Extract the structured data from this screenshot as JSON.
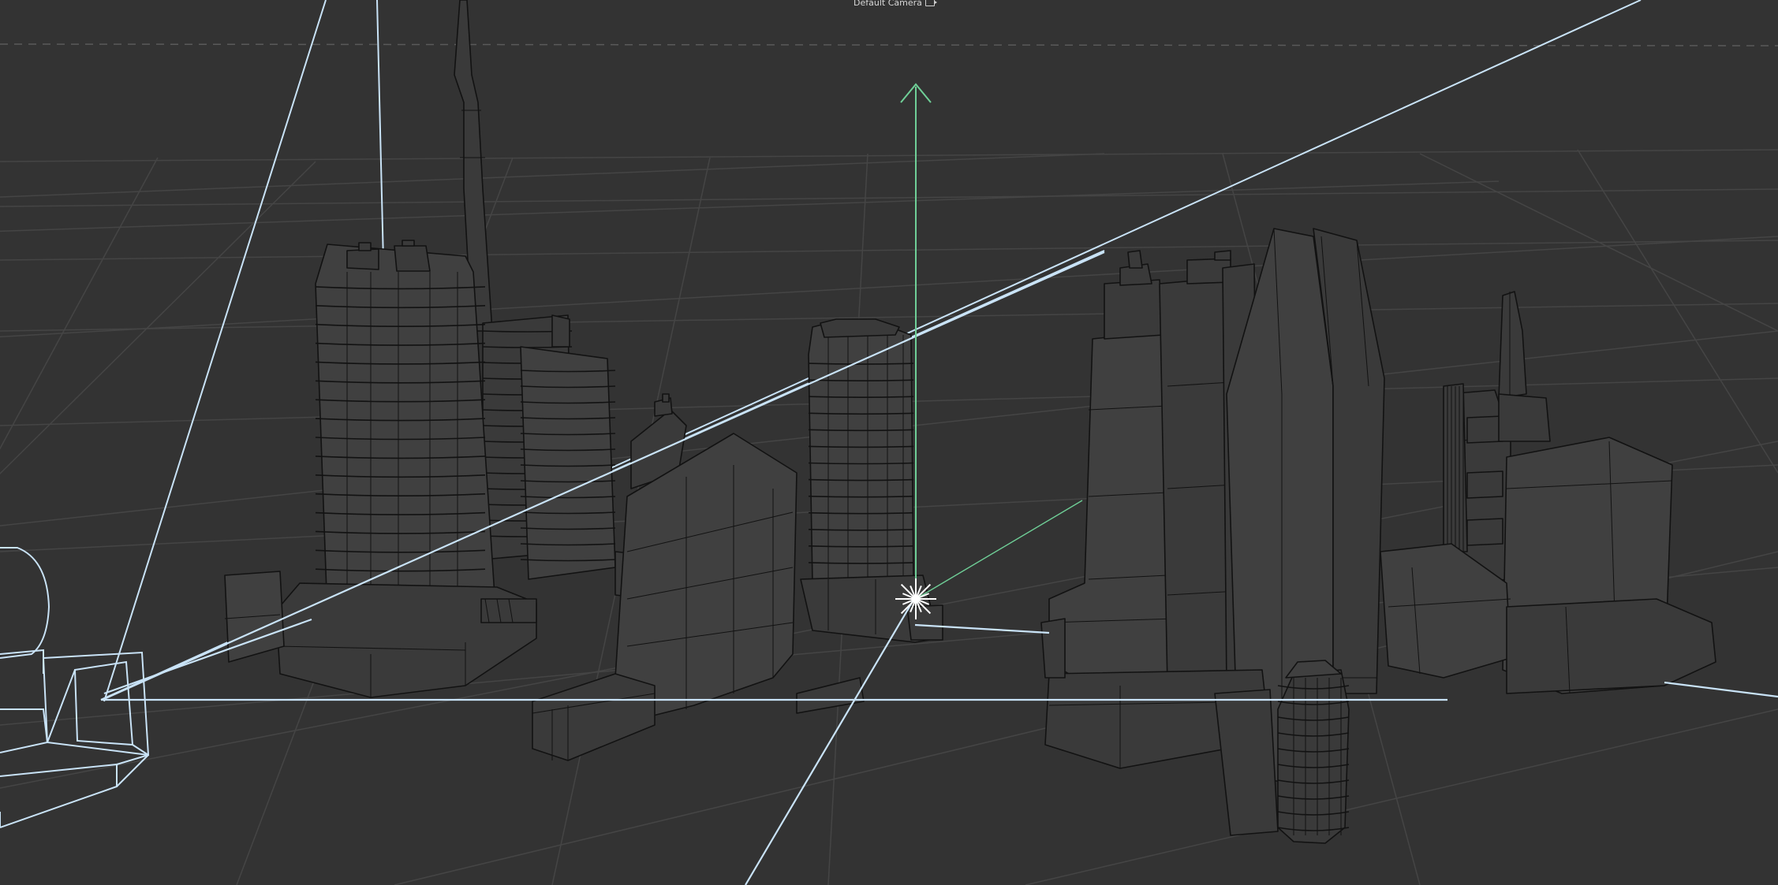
{
  "viewport": {
    "camera_label": "Default Camera",
    "camera_icon": "camera-icon"
  },
  "colors": {
    "background": "#333333",
    "grid": "#454545",
    "grid_strong": "#4a4a4a",
    "horizon_dash": "#5a5a5a",
    "building_fill": "#3a3a3a",
    "building_fill_light": "#404040",
    "building_edge": "#121212",
    "frustum": "#c9e3f7",
    "axis_y": "#6fcf97",
    "axis_x": "#c9e3f7",
    "light": "#ffffff"
  },
  "icons": [
    "camera-icon",
    "light-gizmo-icon",
    "y-axis-arrow-icon"
  ]
}
